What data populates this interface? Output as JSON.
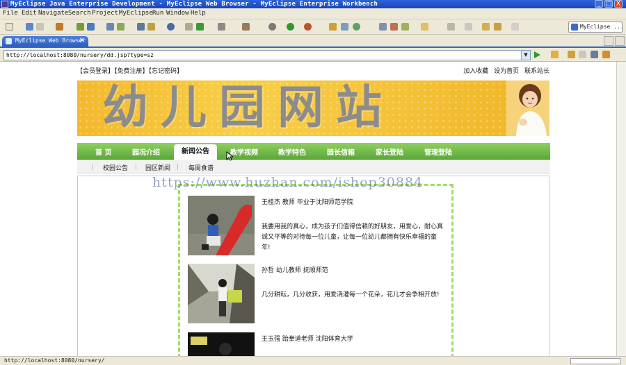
{
  "window": {
    "title": "MyEclipse Java Enterprise Development - MyEclipse Web Browser - MyEclipse Enterprise Workbench",
    "controls": [
      "_",
      "□",
      "X"
    ]
  },
  "menu": [
    "File",
    "Edit",
    "Navigate",
    "Search",
    "Project",
    "MyEclipse",
    "Run",
    "Window",
    "Help"
  ],
  "perspective_label": "MyEclipse ...",
  "editor_tab": {
    "label": "MyEclipse Web Browser",
    "close": "✕"
  },
  "address": {
    "url": "http://localhost:8080/nursery/dd.jsp?type=sz",
    "dropdown": "▼"
  },
  "page": {
    "top_left_links": "【会员登录】【免费注册】【忘记密码】",
    "top_right_links": [
      "加入收藏",
      "设为首页",
      "联系站长"
    ],
    "banner_title": "幼儿园网站",
    "nav": [
      "首 页",
      "园况介绍",
      "新闻公告",
      "教学视频",
      "教学特色",
      "园长信箱",
      "家长登陆",
      "管理登陆"
    ],
    "nav_active": "新闻公告",
    "subnav": [
      "校园公告",
      "园区新闻",
      "每周食谱"
    ],
    "watermark": "https://www.huzhan.com/ishop30884",
    "teachers": [
      {
        "name": "王桂杰 教师 毕业于沈阳师范学院",
        "desc": "我要用我的真心，成为孩子们值得信赖的好朋友，用爱心，耐心真诚又平等的对待每一位儿童，让每一位幼儿都拥有快乐幸福的童年!"
      },
      {
        "name": "孙哲 幼儿教师 抚顺师范",
        "desc": "几分耕耘，几分收获，用爱浇灌每一个花朵，花儿才会争相开放!"
      },
      {
        "name": "王玉强 跆拳道老师 沈阳体育大学",
        "desc": ""
      }
    ]
  },
  "status": {
    "text": "http://localhost:8080/nursery/"
  },
  "colors": {
    "title_blue": "#1f4fc4",
    "nav_green": "#6cb447",
    "banner_yellow": "#f5c33a",
    "dash_green": "#9ee060"
  }
}
